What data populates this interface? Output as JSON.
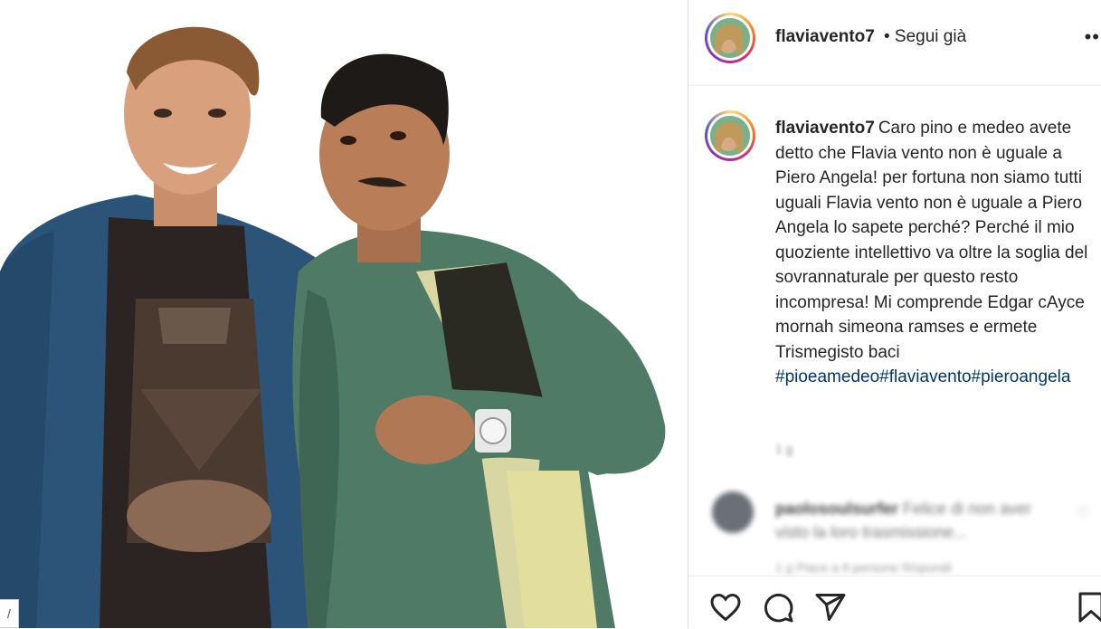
{
  "post": {
    "username": "flaviavento7",
    "follow_status": "• Segui già",
    "more_label": "••",
    "caption_text": "Caro pino e medeo avete detto che Flavia vento non è uguale a Piero Angela! per fortuna non siamo tutti uguali Flavia vento non è uguale a Piero Angela lo sapete perché? Perché il mio quoziente intellettivo va oltre la soglia del sovrannaturale per questo resto incompresa! Mi comprende Edgar cAyce mornah simeona ramses e ermete Trismegisto baci",
    "hashtags": "#pioeamedeo#flaviavento#pieroangela",
    "time_ago": "1 g"
  },
  "comment": {
    "username": "paolosoulsurfer",
    "text": "Felice di non aver visto la loro trasmissione...",
    "meta": "1 g   Piace a 8 persone   Rispondi"
  },
  "photo": {
    "corner_label": "/"
  },
  "icons": {
    "like": "heart-icon",
    "comment": "comment-icon",
    "share": "share-icon",
    "save": "bookmark-icon",
    "options": "more-icon"
  },
  "colors": {
    "username": "#262626",
    "hashtag": "#00376b",
    "jacket_left": "#2c5378",
    "jacket_right": "#4f7a66"
  }
}
